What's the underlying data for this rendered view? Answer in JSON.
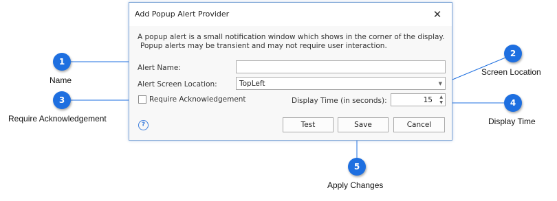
{
  "dialog": {
    "title": "Add Popup Alert Provider",
    "close_glyph": "✕",
    "description_line1": "A popup alert is a small notification window which shows in the corner of the display.",
    "description_line2": "Popup alerts may be transient and may not require user interaction.",
    "alert_name_label": "Alert Name:",
    "alert_name_value": "",
    "screen_location_label": "Alert Screen Location:",
    "screen_location_value": "TopLeft",
    "require_ack_label": "Require Acknowledgement",
    "require_ack_checked": false,
    "display_time_label": "Display Time (in seconds):",
    "display_time_value": "15",
    "help_glyph": "?",
    "buttons": {
      "test": "Test",
      "save": "Save",
      "cancel": "Cancel"
    }
  },
  "callouts": [
    {
      "number": "1",
      "caption": "Name"
    },
    {
      "number": "2",
      "caption": "Screen Location"
    },
    {
      "number": "3",
      "caption": "Require Acknowledgement"
    },
    {
      "number": "4",
      "caption": "Display Time"
    },
    {
      "number": "5",
      "caption": "Apply Changes"
    }
  ],
  "colors": {
    "callout_fill": "#1e6fe0",
    "line": "#1e6fe0",
    "dialog_border": "#7fa6d6"
  }
}
